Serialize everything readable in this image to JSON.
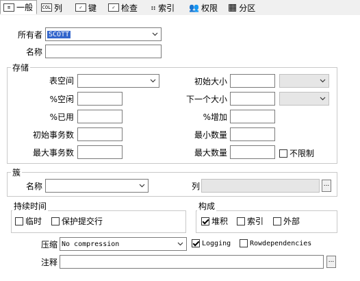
{
  "tabs": [
    {
      "label": "一般",
      "icon": "general-icon"
    },
    {
      "label": "列",
      "icon": "column-icon"
    },
    {
      "label": "键",
      "icon": "key-icon"
    },
    {
      "label": "检查",
      "icon": "check-icon"
    },
    {
      "label": "索引",
      "icon": "index-icon"
    },
    {
      "label": "权限",
      "icon": "users-icon"
    },
    {
      "label": "分区",
      "icon": "grid-icon"
    }
  ],
  "owner": {
    "label": "所有者",
    "value": "SCOTT"
  },
  "name": {
    "label": "名称",
    "value": ""
  },
  "storage": {
    "title": "存储",
    "tablespace": "表空间",
    "pct_free": "%空闲",
    "pct_used": "%已用",
    "ini_trans": "初始事务数",
    "max_trans": "最大事务数",
    "initial": "初始大小",
    "next": "下一个大小",
    "pct_increase": "%增加",
    "min_extents": "最小数量",
    "max_extents": "最大数量",
    "unlimited": "不限制"
  },
  "cluster": {
    "title": "簇",
    "name": "名称",
    "columns": "列"
  },
  "duration": {
    "title": "持续时间",
    "temporary": "临时",
    "preserve": "保护提交行"
  },
  "organization": {
    "title": "构成",
    "heap": "堆积",
    "index": "索引",
    "external": "外部"
  },
  "compress": {
    "label": "压缩",
    "value": "No compression"
  },
  "logging": "Logging",
  "rowdep": "Rowdependencies",
  "comment": {
    "label": "注释",
    "value": ""
  },
  "browse": "..."
}
